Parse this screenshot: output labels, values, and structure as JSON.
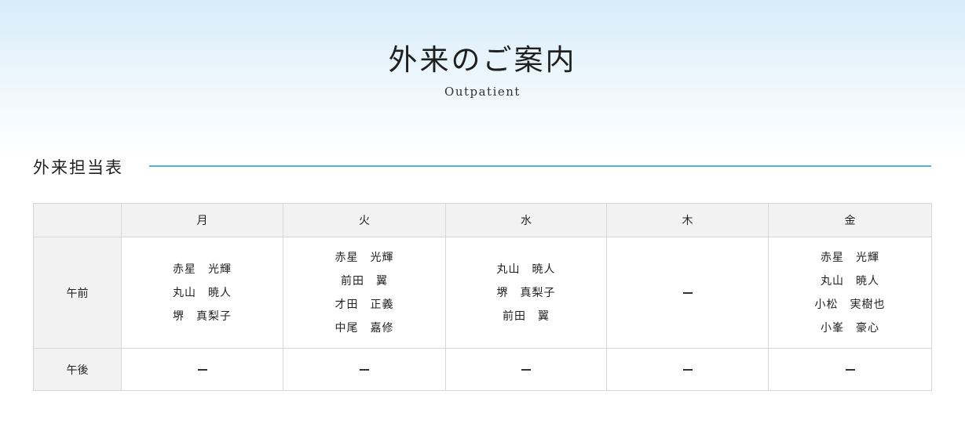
{
  "hero": {
    "title": "外来のご案内",
    "subtitle": "Outpatient"
  },
  "section": {
    "title": "外来担当表",
    "line_color": "#4fb3e8"
  },
  "schedule": {
    "days": [
      "月",
      "火",
      "水",
      "木",
      "金"
    ],
    "rows": [
      {
        "period": "午前",
        "cells": [
          [
            "赤星　光輝",
            "丸山　暁人",
            "堺　真梨子"
          ],
          [
            "赤星　光輝",
            "前田　翼",
            "才田　正義",
            "中尾　嘉修"
          ],
          [
            "丸山　暁人",
            "堺　真梨子",
            "前田　翼"
          ],
          [],
          [
            "赤星　光輝",
            "丸山　暁人",
            "小松　実樹也",
            "小峯　豪心"
          ]
        ]
      },
      {
        "period": "午後",
        "cells": [
          [],
          [],
          [],
          [],
          []
        ]
      }
    ],
    "empty_marker": "dash"
  }
}
